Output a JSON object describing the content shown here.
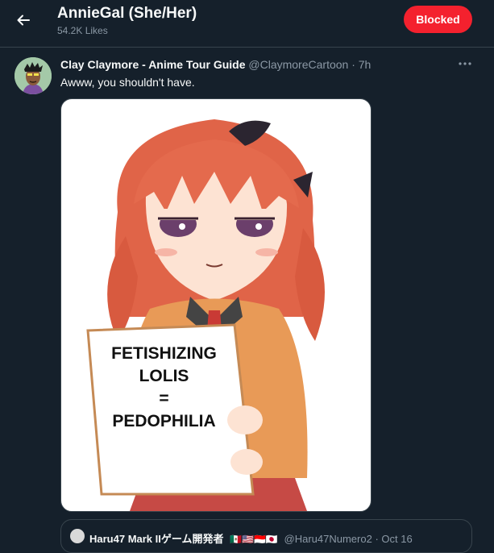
{
  "header": {
    "profile_name": "AnnieGal (She/Her)",
    "likes_count": "54.2K Likes",
    "blocked_label": "Blocked"
  },
  "tweet": {
    "author_name": "Clay Claymore - Anime Tour Guide",
    "author_handle": "@ClaymoreCartoon",
    "separator": "·",
    "time": "7h",
    "text": "Awww, you shouldn't have.",
    "image_sign_lines": [
      "FETISHIZING",
      "LOLIS",
      "=",
      "PEDOPHILIA"
    ]
  },
  "quote": {
    "author_name": "Haru47 Mark IIゲーム開発者",
    "flags": "🇲🇽🇺🇸🇮🇩🇯🇵",
    "author_handle": "@Haru47Numero2",
    "separator": "·",
    "date": "Oct 16"
  },
  "icons": {
    "back": "back-arrow-icon",
    "more": "more-dots-icon"
  },
  "colors": {
    "background": "#15202b",
    "blocked": "#f4212e",
    "secondary_text": "#8b98a5",
    "border": "#38444d"
  }
}
